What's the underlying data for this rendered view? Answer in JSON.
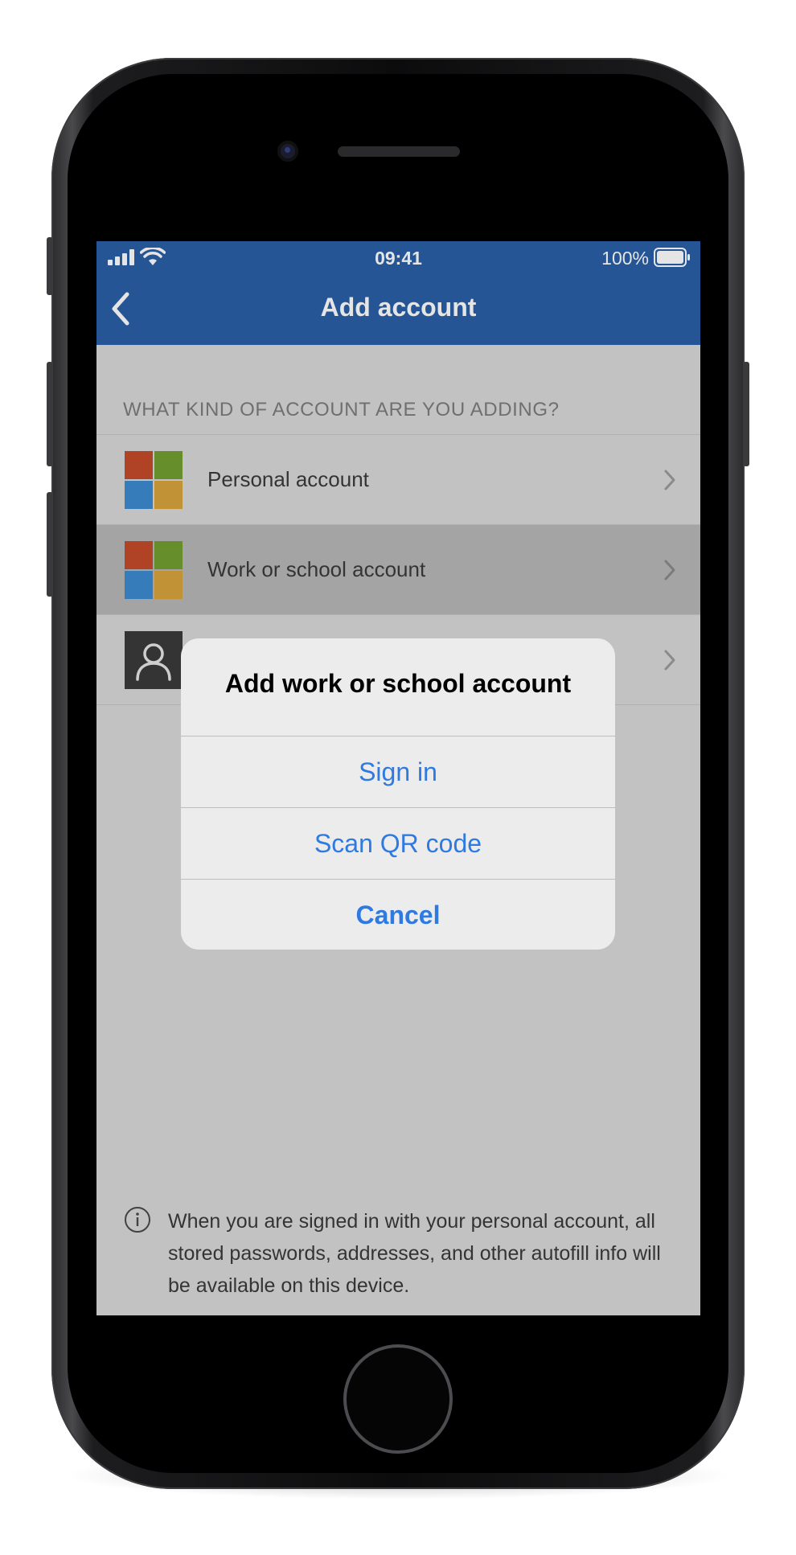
{
  "status_bar": {
    "time": "09:41",
    "battery": "100%"
  },
  "nav": {
    "title": "Add account",
    "back_icon": "chevron-left-icon"
  },
  "section_header": "WHAT KIND OF ACCOUNT ARE YOU ADDING?",
  "accounts": [
    {
      "label": "Personal account",
      "icon": "microsoft-logo-icon",
      "selected": false
    },
    {
      "label": "Work or school account",
      "icon": "microsoft-logo-icon",
      "selected": true
    },
    {
      "label": "",
      "icon": "person-icon",
      "selected": false
    }
  ],
  "footer": {
    "icon": "info-icon",
    "text": "When you are signed in with your personal account, all stored passwords, addresses, and other autofill info will be available on this device."
  },
  "alert": {
    "title": "Add work or school account",
    "sign_in": "Sign in",
    "scan_qr": "Scan QR code",
    "cancel": "Cancel"
  },
  "colors": {
    "brand_blue": "#2b5fa6",
    "action_blue": "#2f7ae0",
    "ms_red": "#c44a2a",
    "ms_green": "#72a032",
    "ms_blue": "#3d8ad0",
    "ms_yellow": "#d7a43d"
  }
}
